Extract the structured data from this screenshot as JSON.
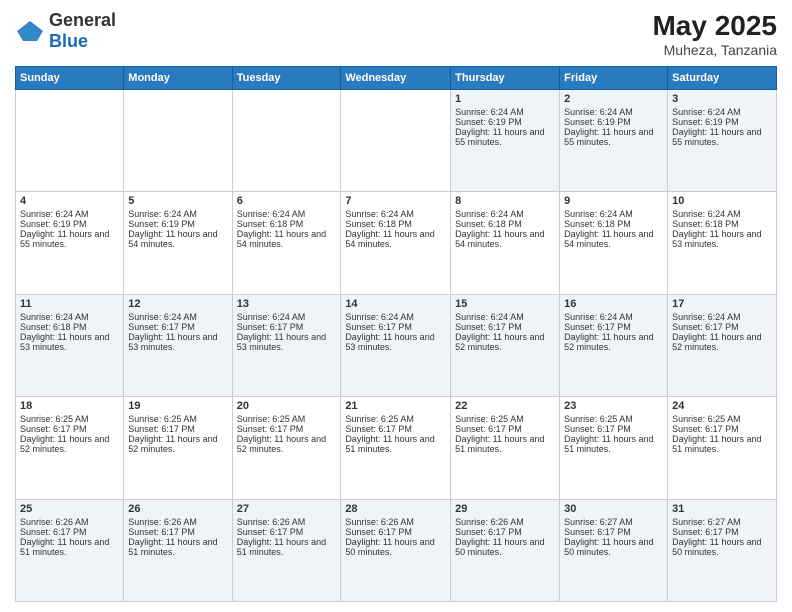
{
  "logo": {
    "general": "General",
    "blue": "Blue"
  },
  "header": {
    "month_year": "May 2025",
    "location": "Muheza, Tanzania"
  },
  "weekdays": [
    "Sunday",
    "Monday",
    "Tuesday",
    "Wednesday",
    "Thursday",
    "Friday",
    "Saturday"
  ],
  "weeks": [
    [
      {
        "day": "",
        "info": ""
      },
      {
        "day": "",
        "info": ""
      },
      {
        "day": "",
        "info": ""
      },
      {
        "day": "",
        "info": ""
      },
      {
        "day": "1",
        "sunrise": "Sunrise: 6:24 AM",
        "sunset": "Sunset: 6:19 PM",
        "daylight": "Daylight: 11 hours and 55 minutes."
      },
      {
        "day": "2",
        "sunrise": "Sunrise: 6:24 AM",
        "sunset": "Sunset: 6:19 PM",
        "daylight": "Daylight: 11 hours and 55 minutes."
      },
      {
        "day": "3",
        "sunrise": "Sunrise: 6:24 AM",
        "sunset": "Sunset: 6:19 PM",
        "daylight": "Daylight: 11 hours and 55 minutes."
      }
    ],
    [
      {
        "day": "4",
        "sunrise": "Sunrise: 6:24 AM",
        "sunset": "Sunset: 6:19 PM",
        "daylight": "Daylight: 11 hours and 55 minutes."
      },
      {
        "day": "5",
        "sunrise": "Sunrise: 6:24 AM",
        "sunset": "Sunset: 6:19 PM",
        "daylight": "Daylight: 11 hours and 54 minutes."
      },
      {
        "day": "6",
        "sunrise": "Sunrise: 6:24 AM",
        "sunset": "Sunset: 6:18 PM",
        "daylight": "Daylight: 11 hours and 54 minutes."
      },
      {
        "day": "7",
        "sunrise": "Sunrise: 6:24 AM",
        "sunset": "Sunset: 6:18 PM",
        "daylight": "Daylight: 11 hours and 54 minutes."
      },
      {
        "day": "8",
        "sunrise": "Sunrise: 6:24 AM",
        "sunset": "Sunset: 6:18 PM",
        "daylight": "Daylight: 11 hours and 54 minutes."
      },
      {
        "day": "9",
        "sunrise": "Sunrise: 6:24 AM",
        "sunset": "Sunset: 6:18 PM",
        "daylight": "Daylight: 11 hours and 54 minutes."
      },
      {
        "day": "10",
        "sunrise": "Sunrise: 6:24 AM",
        "sunset": "Sunset: 6:18 PM",
        "daylight": "Daylight: 11 hours and 53 minutes."
      }
    ],
    [
      {
        "day": "11",
        "sunrise": "Sunrise: 6:24 AM",
        "sunset": "Sunset: 6:18 PM",
        "daylight": "Daylight: 11 hours and 53 minutes."
      },
      {
        "day": "12",
        "sunrise": "Sunrise: 6:24 AM",
        "sunset": "Sunset: 6:17 PM",
        "daylight": "Daylight: 11 hours and 53 minutes."
      },
      {
        "day": "13",
        "sunrise": "Sunrise: 6:24 AM",
        "sunset": "Sunset: 6:17 PM",
        "daylight": "Daylight: 11 hours and 53 minutes."
      },
      {
        "day": "14",
        "sunrise": "Sunrise: 6:24 AM",
        "sunset": "Sunset: 6:17 PM",
        "daylight": "Daylight: 11 hours and 53 minutes."
      },
      {
        "day": "15",
        "sunrise": "Sunrise: 6:24 AM",
        "sunset": "Sunset: 6:17 PM",
        "daylight": "Daylight: 11 hours and 52 minutes."
      },
      {
        "day": "16",
        "sunrise": "Sunrise: 6:24 AM",
        "sunset": "Sunset: 6:17 PM",
        "daylight": "Daylight: 11 hours and 52 minutes."
      },
      {
        "day": "17",
        "sunrise": "Sunrise: 6:24 AM",
        "sunset": "Sunset: 6:17 PM",
        "daylight": "Daylight: 11 hours and 52 minutes."
      }
    ],
    [
      {
        "day": "18",
        "sunrise": "Sunrise: 6:25 AM",
        "sunset": "Sunset: 6:17 PM",
        "daylight": "Daylight: 11 hours and 52 minutes."
      },
      {
        "day": "19",
        "sunrise": "Sunrise: 6:25 AM",
        "sunset": "Sunset: 6:17 PM",
        "daylight": "Daylight: 11 hours and 52 minutes."
      },
      {
        "day": "20",
        "sunrise": "Sunrise: 6:25 AM",
        "sunset": "Sunset: 6:17 PM",
        "daylight": "Daylight: 11 hours and 52 minutes."
      },
      {
        "day": "21",
        "sunrise": "Sunrise: 6:25 AM",
        "sunset": "Sunset: 6:17 PM",
        "daylight": "Daylight: 11 hours and 51 minutes."
      },
      {
        "day": "22",
        "sunrise": "Sunrise: 6:25 AM",
        "sunset": "Sunset: 6:17 PM",
        "daylight": "Daylight: 11 hours and 51 minutes."
      },
      {
        "day": "23",
        "sunrise": "Sunrise: 6:25 AM",
        "sunset": "Sunset: 6:17 PM",
        "daylight": "Daylight: 11 hours and 51 minutes."
      },
      {
        "day": "24",
        "sunrise": "Sunrise: 6:25 AM",
        "sunset": "Sunset: 6:17 PM",
        "daylight": "Daylight: 11 hours and 51 minutes."
      }
    ],
    [
      {
        "day": "25",
        "sunrise": "Sunrise: 6:26 AM",
        "sunset": "Sunset: 6:17 PM",
        "daylight": "Daylight: 11 hours and 51 minutes."
      },
      {
        "day": "26",
        "sunrise": "Sunrise: 6:26 AM",
        "sunset": "Sunset: 6:17 PM",
        "daylight": "Daylight: 11 hours and 51 minutes."
      },
      {
        "day": "27",
        "sunrise": "Sunrise: 6:26 AM",
        "sunset": "Sunset: 6:17 PM",
        "daylight": "Daylight: 11 hours and 51 minutes."
      },
      {
        "day": "28",
        "sunrise": "Sunrise: 6:26 AM",
        "sunset": "Sunset: 6:17 PM",
        "daylight": "Daylight: 11 hours and 50 minutes."
      },
      {
        "day": "29",
        "sunrise": "Sunrise: 6:26 AM",
        "sunset": "Sunset: 6:17 PM",
        "daylight": "Daylight: 11 hours and 50 minutes."
      },
      {
        "day": "30",
        "sunrise": "Sunrise: 6:27 AM",
        "sunset": "Sunset: 6:17 PM",
        "daylight": "Daylight: 11 hours and 50 minutes."
      },
      {
        "day": "31",
        "sunrise": "Sunrise: 6:27 AM",
        "sunset": "Sunset: 6:17 PM",
        "daylight": "Daylight: 11 hours and 50 minutes."
      }
    ]
  ]
}
